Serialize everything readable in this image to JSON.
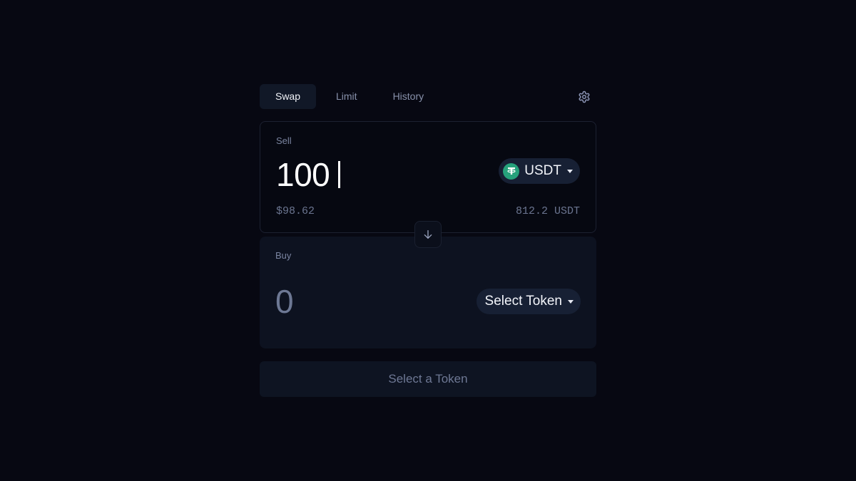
{
  "tabs": [
    {
      "label": "Swap",
      "active": true
    },
    {
      "label": "Limit",
      "active": false
    },
    {
      "label": "History",
      "active": false
    }
  ],
  "sell": {
    "label": "Sell",
    "amount": "100",
    "token": {
      "symbol": "USDT",
      "icon": "tether-icon"
    },
    "usd_value": "$98.62",
    "balance": "812.2 USDT"
  },
  "buy": {
    "label": "Buy",
    "amount": "0",
    "token_button": "Select Token"
  },
  "action_button": "Select a Token",
  "colors": {
    "background": "#070812",
    "tether_green": "#26a17b",
    "muted_text": "#7a84a0"
  }
}
